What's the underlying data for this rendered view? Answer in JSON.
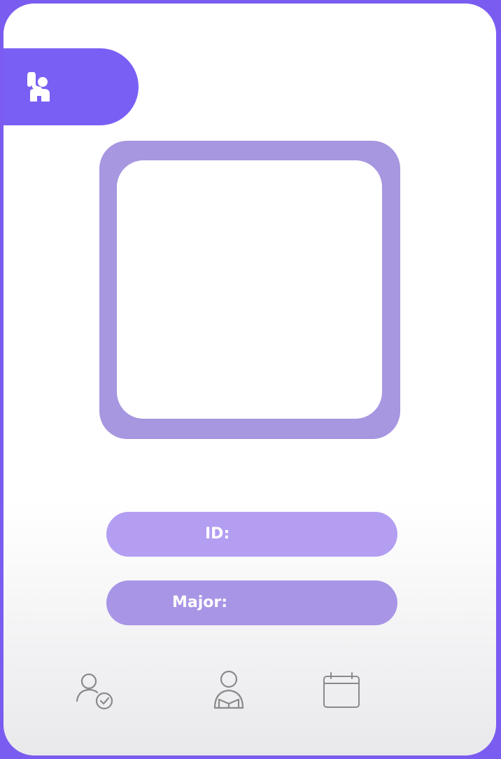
{
  "card": {
    "badge_icon": "raised-hand-person-icon",
    "photo_placeholder": "",
    "id_label": "ID:",
    "major_label": "Major:"
  },
  "bottom_nav": {
    "items": [
      {
        "icon": "user-check-icon"
      },
      {
        "icon": "student-reading-icon"
      },
      {
        "icon": "calendar-icon"
      }
    ]
  },
  "colors": {
    "background": "#7b5cf0",
    "tab": "#7a5ff5",
    "photo_border": "#a796e0",
    "field_id": "#b39ef2",
    "field_major": "#a995e6",
    "icon_stroke": "#8a8a8a"
  }
}
